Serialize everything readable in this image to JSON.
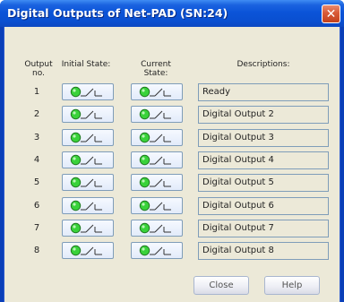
{
  "window": {
    "title": "Digital Outputs of Net-PAD (SN:24)",
    "close_glyph": "✕"
  },
  "headers": {
    "output_no": "Output no.",
    "initial_state": "Initial State:",
    "current_state": "Current State:",
    "descriptions": "Descriptions:"
  },
  "rows": [
    {
      "no": "1",
      "description": "Ready",
      "initial_state": "off",
      "current_state": "off"
    },
    {
      "no": "2",
      "description": "Digital Output 2",
      "initial_state": "off",
      "current_state": "off"
    },
    {
      "no": "3",
      "description": "Digital Output 3",
      "initial_state": "off",
      "current_state": "off"
    },
    {
      "no": "4",
      "description": "Digital Output 4",
      "initial_state": "off",
      "current_state": "off"
    },
    {
      "no": "5",
      "description": "Digital Output 5",
      "initial_state": "off",
      "current_state": "off"
    },
    {
      "no": "6",
      "description": "Digital Output 6",
      "initial_state": "off",
      "current_state": "off"
    },
    {
      "no": "7",
      "description": "Digital Output 7",
      "initial_state": "off",
      "current_state": "off"
    },
    {
      "no": "8",
      "description": "Digital Output 8",
      "initial_state": "off",
      "current_state": "off"
    }
  ],
  "buttons": {
    "close": "Close",
    "help": "Help"
  },
  "icons": {
    "state_indicator": "green-led-open-switch-icon",
    "close": "close-icon"
  },
  "colors": {
    "led_green": "#39d23a",
    "titlebar_blue": "#0b54d8",
    "close_red": "#d85a36"
  }
}
